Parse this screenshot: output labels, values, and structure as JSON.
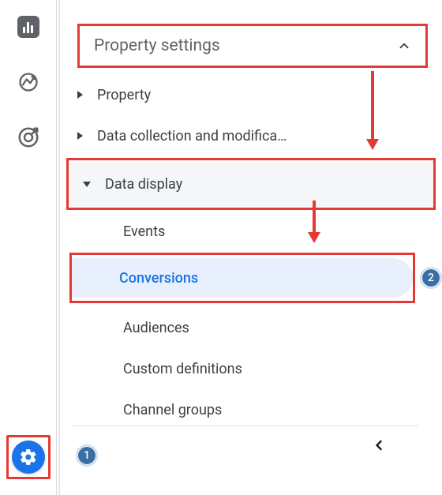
{
  "rail": {
    "reports_icon": "reports",
    "explore_icon": "explore",
    "ads_icon": "ads",
    "admin_icon": "admin"
  },
  "section": {
    "title": "Property settings"
  },
  "nav": {
    "property": "Property",
    "data_collection": "Data collection and modifica…",
    "data_display": "Data display",
    "events": "Events",
    "conversions": "Conversions",
    "audiences": "Audiences",
    "custom_definitions": "Custom definitions",
    "channel_groups": "Channel groups"
  },
  "annotations": {
    "step1": "1",
    "step2": "2"
  },
  "colors": {
    "highlight": "#e53935",
    "primary": "#1a73e8",
    "selected_bg": "#e8f0fe"
  }
}
